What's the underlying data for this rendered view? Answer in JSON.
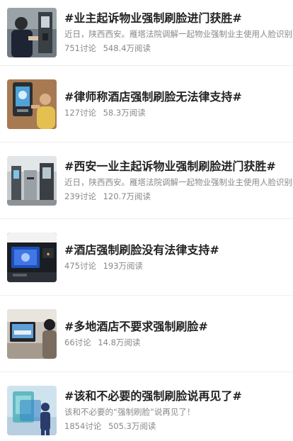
{
  "topics": [
    {
      "title": "#业主起诉物业强制刷脸进门获胜#",
      "desc": "近日，陕西西安。雁塔法院调解一起物业强制业主使用人脸识别",
      "discussions": "751讨论",
      "reads": "548.4万阅读"
    },
    {
      "title": "#律师称酒店强制刷脸无法律支持#",
      "desc": "",
      "discussions": "127讨论",
      "reads": "58.3万阅读"
    },
    {
      "title": "#西安一业主起诉物业强制刷脸进门获胜#",
      "desc": "近日，陕西西安。雁塔法院调解一起物业强制业主使用人脸识别",
      "discussions": "239讨论",
      "reads": "120.7万阅读"
    },
    {
      "title": "#酒店强制刷脸没有法律支持#",
      "desc": "",
      "discussions": "475讨论",
      "reads": "193万阅读"
    },
    {
      "title": "#多地酒店不要求强制刷脸#",
      "desc": "",
      "discussions": "66讨论",
      "reads": "14.8万阅读"
    },
    {
      "title": "#该和不必要的强制刷脸说再见了#",
      "desc": "该和不必要的“强制刷脸”说再见了！",
      "discussions": "1854讨论",
      "reads": "505.3万阅读"
    }
  ]
}
